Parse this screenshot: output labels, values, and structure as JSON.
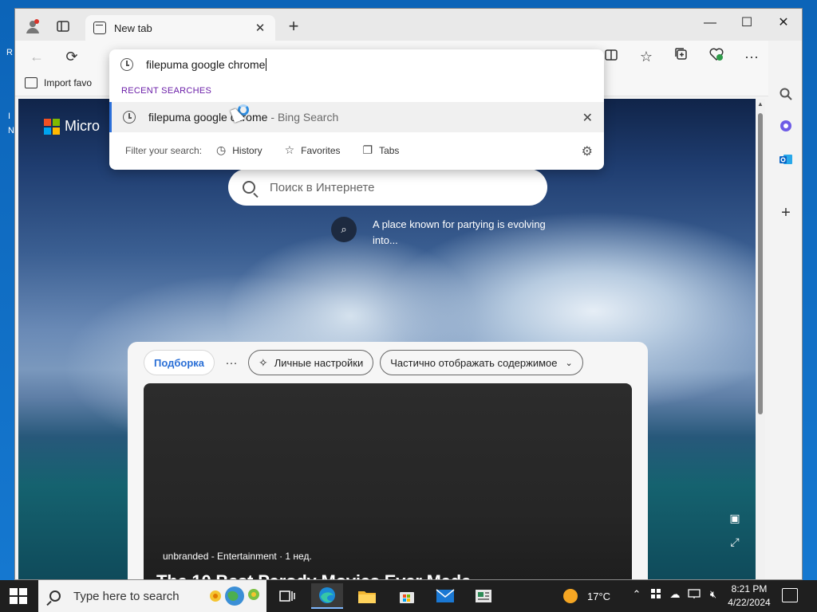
{
  "browser": {
    "tab_title": "New tab",
    "favorites_bar": {
      "import_label": "Import favo"
    }
  },
  "omnibox": {
    "typed": "filepuma google chrome",
    "section_heading": "RECENT SEARCHES",
    "suggestion": {
      "text": "filepuma google chrome",
      "suffix": "- Bing Search"
    },
    "filter_label": "Filter your search:",
    "filters": [
      "History",
      "Favorites",
      "Tabs"
    ]
  },
  "page": {
    "logo_text": "Micro",
    "search_placeholder": "Поиск в Интернете",
    "spotlight_text": "A place known for partying is evolving into...",
    "feed": {
      "tab_active": "Подборка",
      "more": "···",
      "personalize": "Личные настройки",
      "display_dropdown": "Частично отображать содержимое",
      "card": {
        "meta": "unbranded - Entertainment · 1 нед.",
        "headline": "The 10 Best Parody Movies Ever Made"
      }
    }
  },
  "taskbar": {
    "search_placeholder": "Type here to search",
    "weather": "17°C",
    "time": "8:21 PM",
    "date": "4/22/2024"
  },
  "colors": {
    "accent": "#2b6fd9",
    "section_heading": "#6b1fa8",
    "taskbar": "#1f1f1f"
  }
}
